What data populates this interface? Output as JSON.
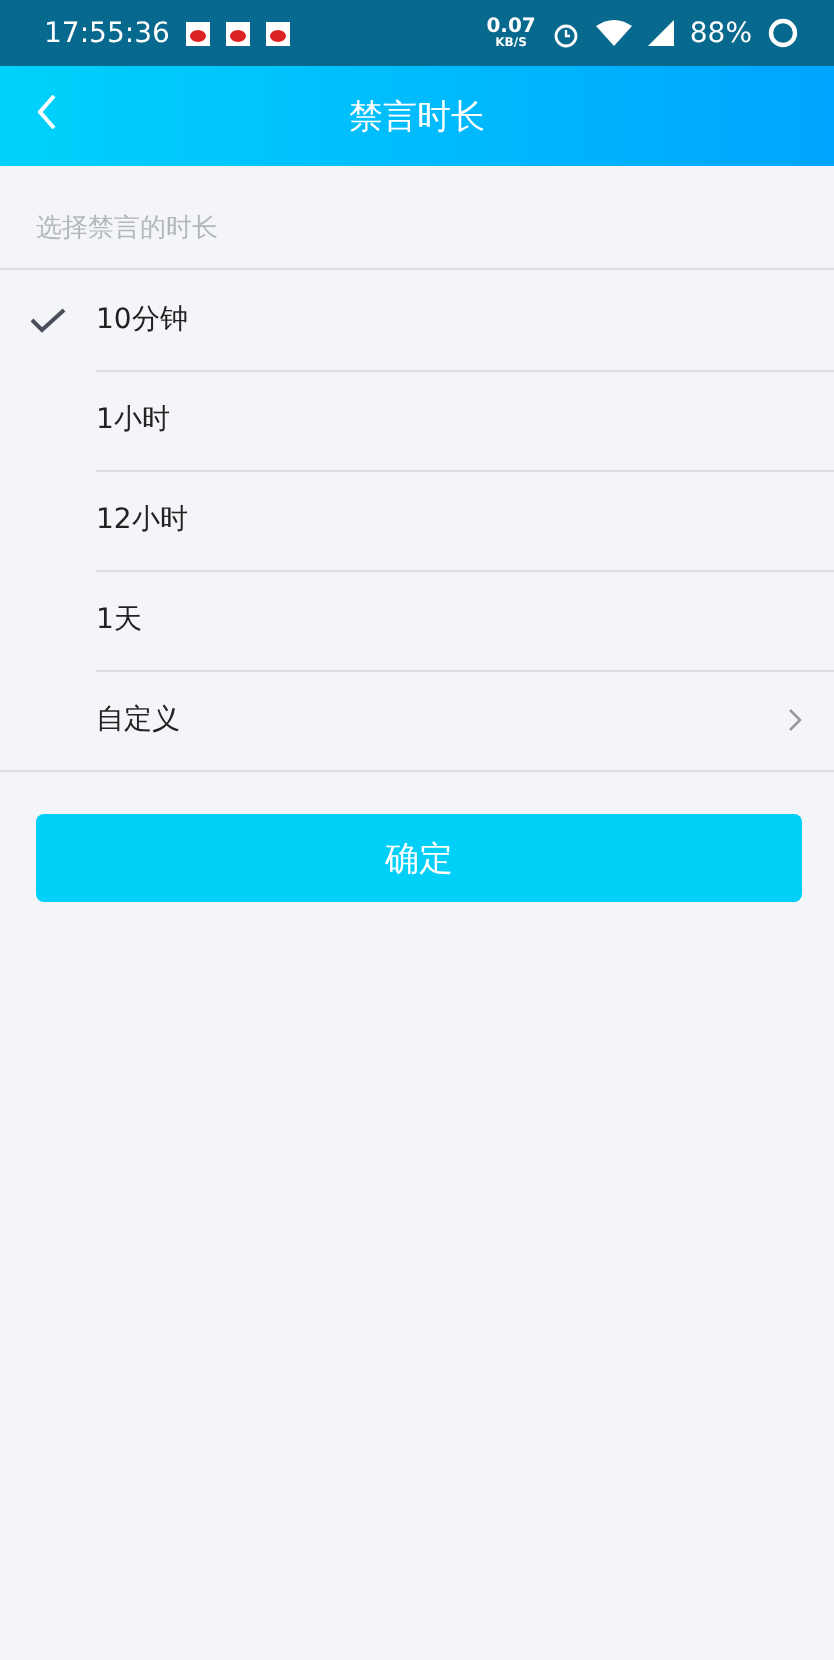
{
  "status_bar": {
    "time": "17:55:36",
    "net_speed": "0.07",
    "net_unit": "KB/S",
    "battery": "88%"
  },
  "header": {
    "title": "禁言时长"
  },
  "section_label": "选择禁言的时长",
  "options": [
    {
      "label": "10分钟",
      "kind": "choice",
      "selected": true
    },
    {
      "label": "1小时",
      "kind": "choice",
      "selected": false
    },
    {
      "label": "12小时",
      "kind": "choice",
      "selected": false
    },
    {
      "label": "1天",
      "kind": "choice",
      "selected": false
    },
    {
      "label": "自定义",
      "kind": "link",
      "selected": false
    }
  ],
  "confirm_button": "确定"
}
